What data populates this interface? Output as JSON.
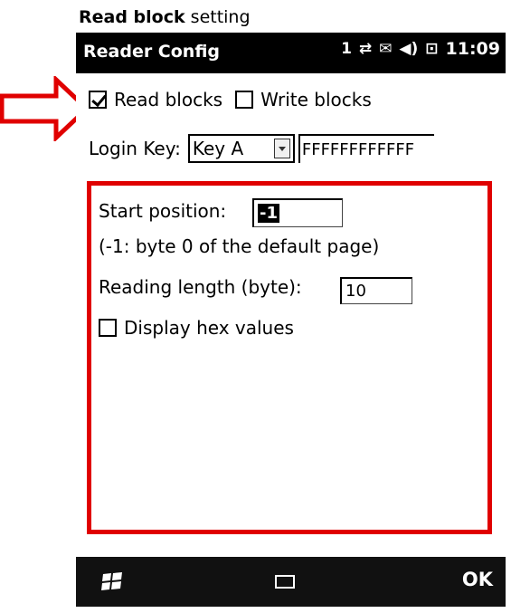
{
  "caption": {
    "bold": "Read block",
    "rest": " setting"
  },
  "titlebar": {
    "title": "Reader Config",
    "signal_icon": "1",
    "time": "11:09"
  },
  "options": {
    "read_blocks": {
      "label": "Read blocks",
      "checked": true
    },
    "write_blocks": {
      "label": "Write blocks",
      "checked": false
    }
  },
  "login": {
    "label": "Login Key:",
    "key_type": "Key A",
    "key_value": "FFFFFFFFFFFF"
  },
  "read_settings": {
    "start_label": "Start position:",
    "start_value": "-1",
    "start_hint": "(-1: byte 0 of the default page)",
    "length_label": "Reading length (byte):",
    "length_value": "10",
    "hex_label": "Display hex values",
    "hex_checked": false
  },
  "bottombar": {
    "ok_label": "OK"
  },
  "colors": {
    "highlight": "#e00000",
    "bar": "#000000"
  }
}
